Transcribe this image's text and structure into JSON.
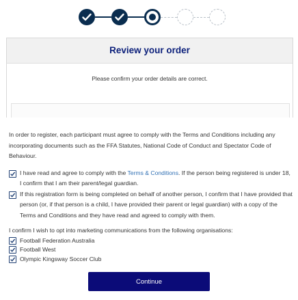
{
  "stepper": {
    "steps": [
      {
        "status": "complete"
      },
      {
        "status": "complete"
      },
      {
        "status": "current"
      },
      {
        "status": "upcoming"
      },
      {
        "status": "upcoming"
      }
    ],
    "color": "#0a2d4f"
  },
  "review": {
    "title": "Review your order",
    "subtitle": "Please confirm your order details are correct."
  },
  "terms": {
    "intro": "In order to register, each participant must agree to comply with the Terms and Conditions including any incorporating documents such as the FFA Statutes, National Code of Conduct and Spectator Code of Behaviour.",
    "agree_before": "I have read and agree to comply with the ",
    "agree_link": "Terms & Conditions",
    "agree_after": ". If the person being registered is under 18, I confirm that I am their parent/legal guardian.",
    "behalf": "If this registration form is being completed on behalf of another person, I confirm that I have provided that person (or, if that person is a child, I have provided their parent or legal guardian) with a copy of the Terms and Conditions and they have read and agreed to comply with them.",
    "marketing_intro": "I confirm I wish to opt into marketing communications from the following organisations:",
    "organisations": [
      "Football Federation Australia",
      "Football West",
      "Olympic Kingsway Soccer Club"
    ]
  },
  "checkbox_states": {
    "agree": true,
    "behalf": true,
    "organisations": [
      true,
      true,
      true
    ]
  },
  "continue_label": "Continue",
  "colors": {
    "primary_navy": "#0b0b78",
    "title_blue": "#0b1f7a",
    "link_blue": "#2f6fb3"
  }
}
